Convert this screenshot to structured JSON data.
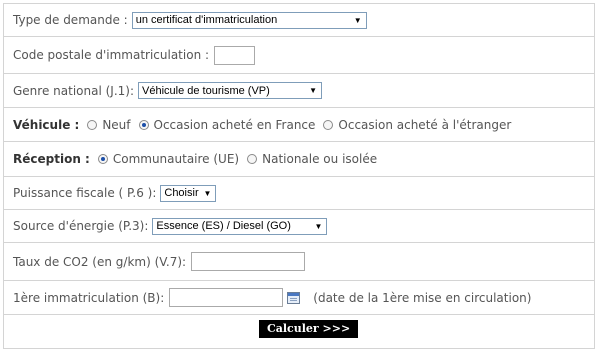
{
  "type_demande": {
    "label": "Type de demande  :",
    "value": "un certificat d'immatriculation"
  },
  "code_postal": {
    "label": "Code postale d'immatriculation :",
    "value": ""
  },
  "genre_national": {
    "label": "Genre national (J.1):",
    "value": "Véhicule de tourisme (VP)"
  },
  "vehicule": {
    "label": "Véhicule :",
    "options": [
      "Neuf",
      "Occasion acheté en France",
      "Occasion acheté à l'étranger"
    ],
    "selected": "Occasion acheté en France"
  },
  "reception": {
    "label": "Réception :",
    "options": [
      "Communautaire (UE)",
      "Nationale ou isolée"
    ],
    "selected": "Communautaire (UE)"
  },
  "puissance_fiscale": {
    "label": "Puissance fiscale ( P.6 ):",
    "value": "Choisir"
  },
  "source_energie": {
    "label": "Source d'énergie (P.3):",
    "value": "Essence (ES) / Diesel (GO)"
  },
  "taux_co2": {
    "label": "Taux de CO2 (en g/km) (V.7):",
    "value": ""
  },
  "premiere_immat": {
    "label": "1ère immatriculation (B):",
    "value": "",
    "hint": "(date de la 1ère mise en circulation)"
  },
  "submit": {
    "label": "Calculer >>>"
  }
}
